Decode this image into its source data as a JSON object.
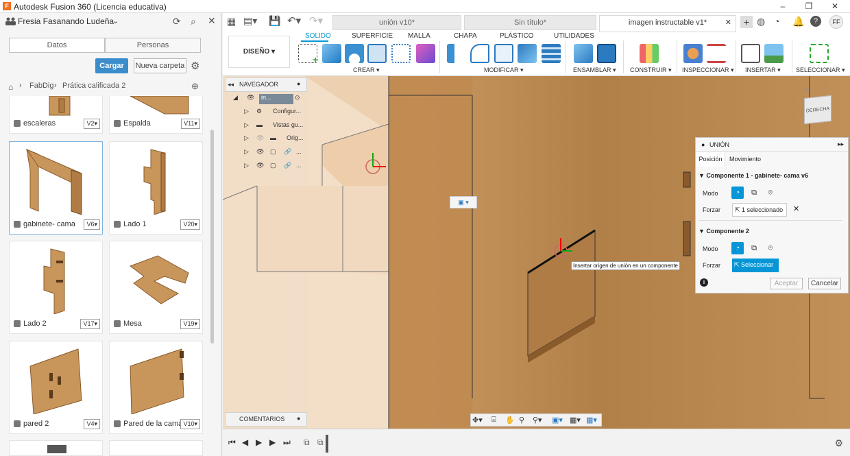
{
  "window": {
    "title": "Autodesk Fusion 360 (Licencia educativa)",
    "controls": [
      "–",
      "❐",
      "✕"
    ]
  },
  "left_panel": {
    "user": "Fresia Fasanando Ludeña",
    "tabs": [
      "Datos",
      "Personas"
    ],
    "upload_label": "Cargar",
    "new_folder_label": "Nueva carpeta",
    "breadcrumb": [
      "FabDig",
      "Prática calificada 2"
    ],
    "files": [
      {
        "name": "escaleras",
        "version": "V2▾"
      },
      {
        "name": "Espalda",
        "version": "V11▾"
      },
      {
        "name": "gabinete- cama",
        "version": "V6▾"
      },
      {
        "name": "Lado 1",
        "version": "V20▾"
      },
      {
        "name": "Lado 2",
        "version": "V17▾"
      },
      {
        "name": "Mesa",
        "version": "V19▾"
      },
      {
        "name": "pared 2",
        "version": "V4▾"
      },
      {
        "name": "Pared de la cama",
        "version": "V10▾"
      }
    ]
  },
  "doc_tabs": [
    {
      "label": "unión v10*"
    },
    {
      "label": "Sin título*"
    },
    {
      "label": "imagen instructable v1*"
    }
  ],
  "ribbon": {
    "workspace": "DISEÑO ▾",
    "tabs": [
      "SOLIDO",
      "SUPERFICIE",
      "MALLA",
      "CHAPA",
      "PLÁSTICO",
      "UTILIDADES"
    ],
    "groups": [
      "CREAR ▾",
      "MODIFICAR ▾",
      "ENSAMBLAR ▾",
      "CONSTRUIR ▾",
      "INSPECCIONAR ▾",
      "INSERTAR ▾",
      "SELECCIONAR ▾"
    ]
  },
  "browser": {
    "title": "NAVEGADOR",
    "items": [
      "in...",
      "Configur...",
      "Vistas gu...",
      "Orig...",
      "...",
      "..."
    ]
  },
  "comments_label": "COMENTARIOS",
  "viewcube_label": "DERECHA",
  "joint_dialog": {
    "title": "UNIÓN",
    "tabs": [
      "Posición",
      "Movimiento"
    ],
    "component1": "Componente 1 - gabinete- cama v6",
    "component2": "Componente 2",
    "mode_label": "Modo",
    "force_label": "Forzar",
    "selected": "1 seleccionado",
    "select_button": "Seleccionar",
    "ok": "Aceptar",
    "cancel": "Cancelar"
  },
  "tooltip": "Insertar origen de unión en un componente",
  "user_initials": "FF",
  "colors": {
    "accent": "#0696d7",
    "wood": "#b88b52",
    "blue_button": "#3c8dcb"
  }
}
